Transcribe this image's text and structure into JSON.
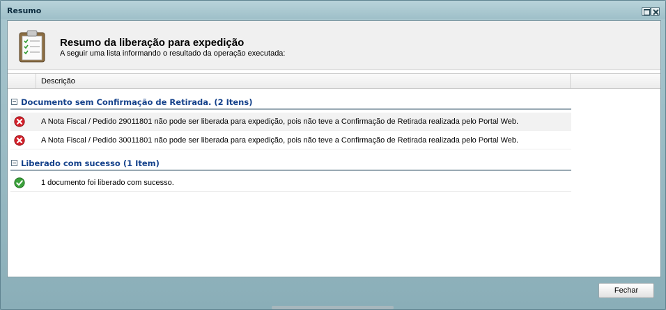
{
  "window": {
    "title": "Resumo"
  },
  "header": {
    "title": "Resumo da liberação para expedição",
    "subtitle": "A seguir uma lista informando o resultado da operação executada:"
  },
  "grid": {
    "column_description": "Descrição"
  },
  "groups": [
    {
      "label": "Documento sem Confirmação de Retirada. (2 Itens)",
      "status": "error",
      "rows": [
        "A Nota Fiscal / Pedido 29011801 não pode ser liberada para expedição, pois não teve a Confirmação de Retirada realizada pelo Portal Web.",
        "A Nota Fiscal / Pedido 30011801 não pode ser liberada para expedição, pois não teve a Confirmação de Retirada realizada pelo Portal Web."
      ]
    },
    {
      "label": "Liberado com sucesso (1 Item)",
      "status": "success",
      "rows": [
        "1 documento foi liberado com sucesso."
      ]
    }
  ],
  "footer": {
    "close_label": "Fechar"
  },
  "colors": {
    "group_text": "#15428b",
    "error": "#d4202a",
    "success": "#3aa03a"
  }
}
